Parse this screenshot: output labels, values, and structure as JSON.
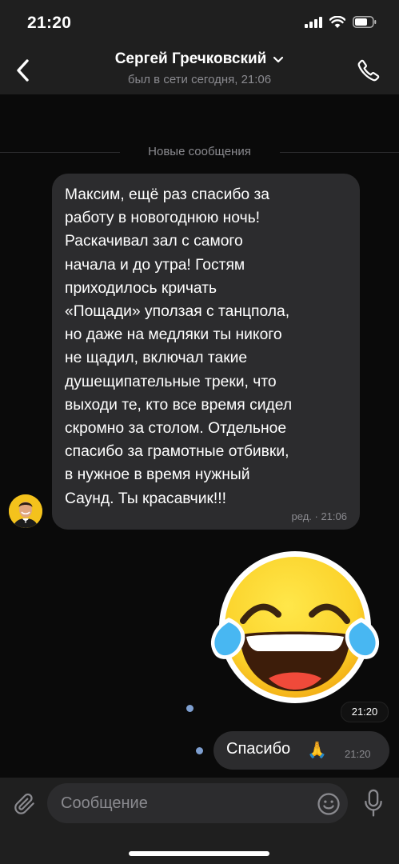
{
  "status_bar": {
    "time": "21:20",
    "icons": [
      "signal-icon",
      "wifi-icon",
      "battery-icon"
    ]
  },
  "header": {
    "back_icon": "chevron-left-icon",
    "contact_name": "Сергей Гречковский",
    "status": "был в сети сегодня, 21:06",
    "dropdown_icon": "chevron-down-icon",
    "call_icon": "phone-icon"
  },
  "divider": {
    "label": "Новые сообщения"
  },
  "incoming": {
    "text": "Максим, ещё раз спасибо за\nработу в новогоднюю ночь!\nРаскачивал зал с самого\nначала и до утра! Гостям\nприходилось кричать\n«Пощади» уползая с танцпола,\nно даже на медляки ты никого\nне щадил, включал такие\nдушещипательные треки, что\nвыходи те, кто все время сидел\nскромно за столом. Отдельное\nспасибо за грамотные отбивки,\nв нужное в время нужный\nСаунд. Ты красавчик!!!",
    "meta": "ред. · 21:06"
  },
  "sticker": {
    "icon": "laughing-tears-emoji-sticker",
    "time": "21:20"
  },
  "outgoing": {
    "text": "Спасибо",
    "emoji": "🙏",
    "time": "21:20"
  },
  "composer": {
    "placeholder": "Сообщение",
    "value": "",
    "attach_icon": "paperclip-icon",
    "emoji_icon": "smiley-icon",
    "mic_icon": "microphone-icon"
  },
  "colors": {
    "background": "#0a0a0a",
    "bars": "#1f1f1f",
    "bubble": "#2c2c2e",
    "secondary_text": "#8a8a8f",
    "unread_dot": "#7e9fd0"
  }
}
